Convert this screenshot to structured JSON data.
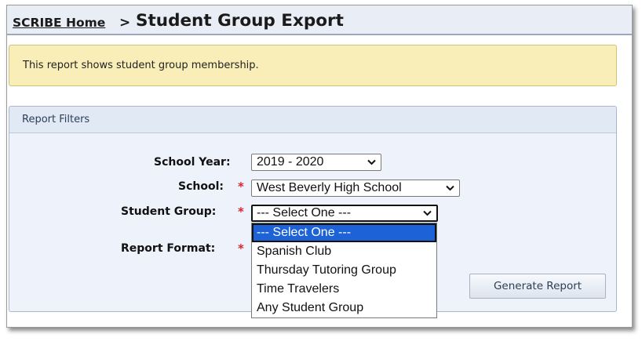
{
  "header": {
    "home_link": "SCRIBE Home",
    "separator": ">",
    "title": "Student Group Export"
  },
  "info": {
    "message": "This report shows student group membership."
  },
  "filters": {
    "panel_title": "Report Filters",
    "school_year": {
      "label": "School Year:",
      "value": "2019 - 2020"
    },
    "school": {
      "label": "School:",
      "required_mark": "*",
      "value": "West Beverly High School"
    },
    "student_group": {
      "label": "Student Group:",
      "required_mark": "*",
      "value": "--- Select One ---",
      "options": [
        "--- Select One ---",
        "Spanish Club",
        "Thursday Tutoring Group",
        "Time Travelers",
        "Any Student Group"
      ]
    },
    "report_format": {
      "label": "Report Format:",
      "required_mark": "*"
    }
  },
  "actions": {
    "generate_label": "Generate Report"
  },
  "icons": {
    "select_chevron": "chevron-down-icon"
  },
  "colors": {
    "required": "#d8262e",
    "highlight": "#1d62d6",
    "info_bg": "#f9eeb8"
  }
}
